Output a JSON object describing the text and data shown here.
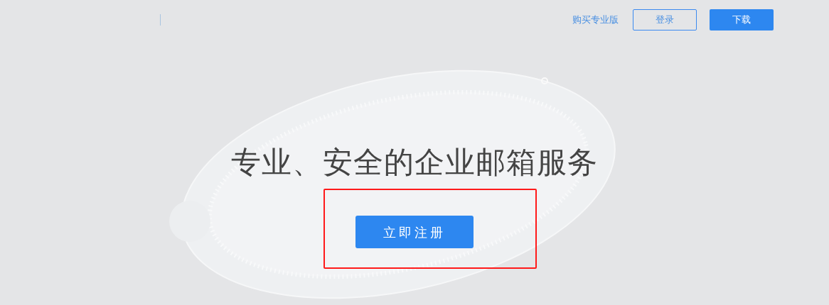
{
  "header": {
    "links": [
      {
        "kind": "link",
        "label": "购买专业版"
      },
      {
        "kind": "outline",
        "label": "登录"
      },
      {
        "kind": "primary",
        "label": "下载"
      }
    ]
  },
  "hero": {
    "title": "专业、安全的企业邮箱服务",
    "cta": "立即注册"
  }
}
